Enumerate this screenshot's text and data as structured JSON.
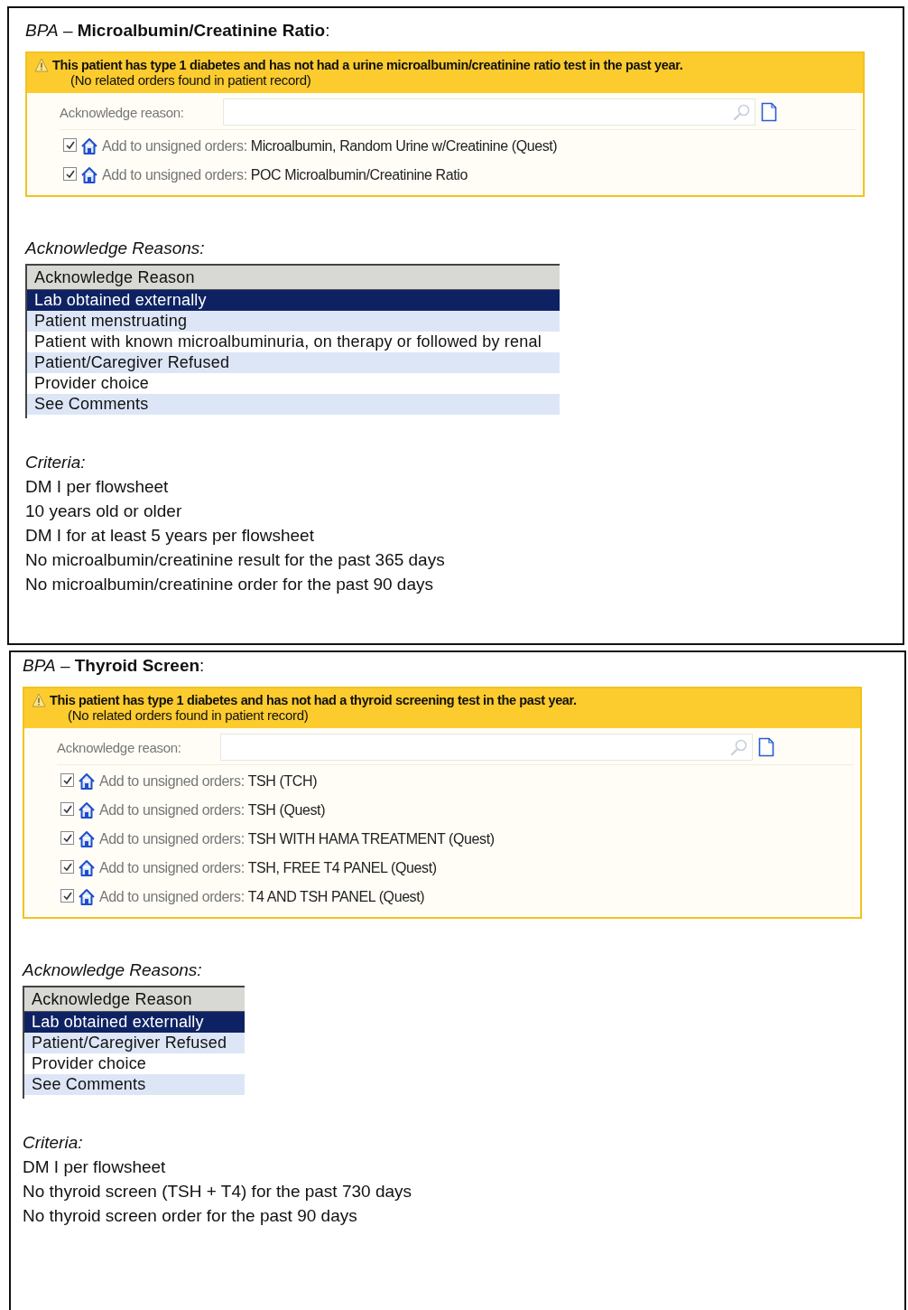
{
  "sections": [
    {
      "title": "*BPA* – **Microalbumin/Creatinine Ratio**:",
      "alert": {
        "message": "This patient has type 1 diabetes and has not had a urine microalbumin/creatinine ratio test in the past year.",
        "note": "(No related orders found in patient record)",
        "acknowledge_label": "Acknowledge reason:",
        "orders": [
          {
            "label": "Add to unsigned orders:",
            "order": "Microalbumin, Random Urine w/Creatinine (Quest)",
            "checked": true
          },
          {
            "label": "Add to unsigned orders:",
            "order": "POC Microalbumin/Creatinine Ratio",
            "checked": true
          }
        ]
      },
      "reasons_heading": "Acknowledge Reasons:",
      "reasons_list": {
        "header": "Acknowledge Reason",
        "items": [
          {
            "label": "Lab obtained externally",
            "selected": true
          },
          {
            "label": "Patient menstruating",
            "selected": false
          },
          {
            "label": "Patient with known microalbuminuria, on therapy or followed by renal",
            "selected": false
          },
          {
            "label": "Patient/Caregiver Refused",
            "selected": false
          },
          {
            "label": "Provider choice",
            "selected": false
          },
          {
            "label": "See Comments",
            "selected": false
          }
        ]
      },
      "criteria_heading": "Criteria:",
      "criteria": [
        "DM I per flowsheet",
        "10 years old or older",
        "DM I for at least 5 years per flowsheet",
        "No microalbumin/creatinine result for the past 365 days",
        "No microalbumin/creatinine order for the past 90 days"
      ]
    },
    {
      "title": "*BPA* – **Thyroid Screen**:",
      "alert": {
        "message": "This patient has type 1 diabetes and has not had a thyroid screening test in the past year.",
        "note": "(No related orders found in patient record)",
        "acknowledge_label": "Acknowledge reason:",
        "orders": [
          {
            "label": "Add to unsigned orders:",
            "order": "TSH (TCH)",
            "checked": true
          },
          {
            "label": "Add to unsigned orders:",
            "order": "TSH (Quest)",
            "checked": true
          },
          {
            "label": "Add to unsigned orders:",
            "order": "TSH WITH HAMA TREATMENT (Quest)",
            "checked": true
          },
          {
            "label": "Add to unsigned orders:",
            "order": "TSH, FREE T4 PANEL (Quest)",
            "checked": true
          },
          {
            "label": "Add to unsigned orders:",
            "order": "T4 AND TSH PANEL (Quest)",
            "checked": true
          }
        ]
      },
      "reasons_heading": "Acknowledge Reasons:",
      "reasons_list": {
        "header": "Acknowledge Reason",
        "items": [
          {
            "label": "Lab obtained externally",
            "selected": true
          },
          {
            "label": "Patient/Caregiver Refused",
            "selected": false
          },
          {
            "label": "Provider choice",
            "selected": false
          },
          {
            "label": "See Comments",
            "selected": false
          }
        ]
      },
      "criteria_heading": "Criteria:",
      "criteria": [
        "DM I per flowsheet",
        "No thyroid screen (TSH + T4) for the past 730 days",
        "No thyroid screen order for the past 90 days"
      ]
    }
  ]
}
